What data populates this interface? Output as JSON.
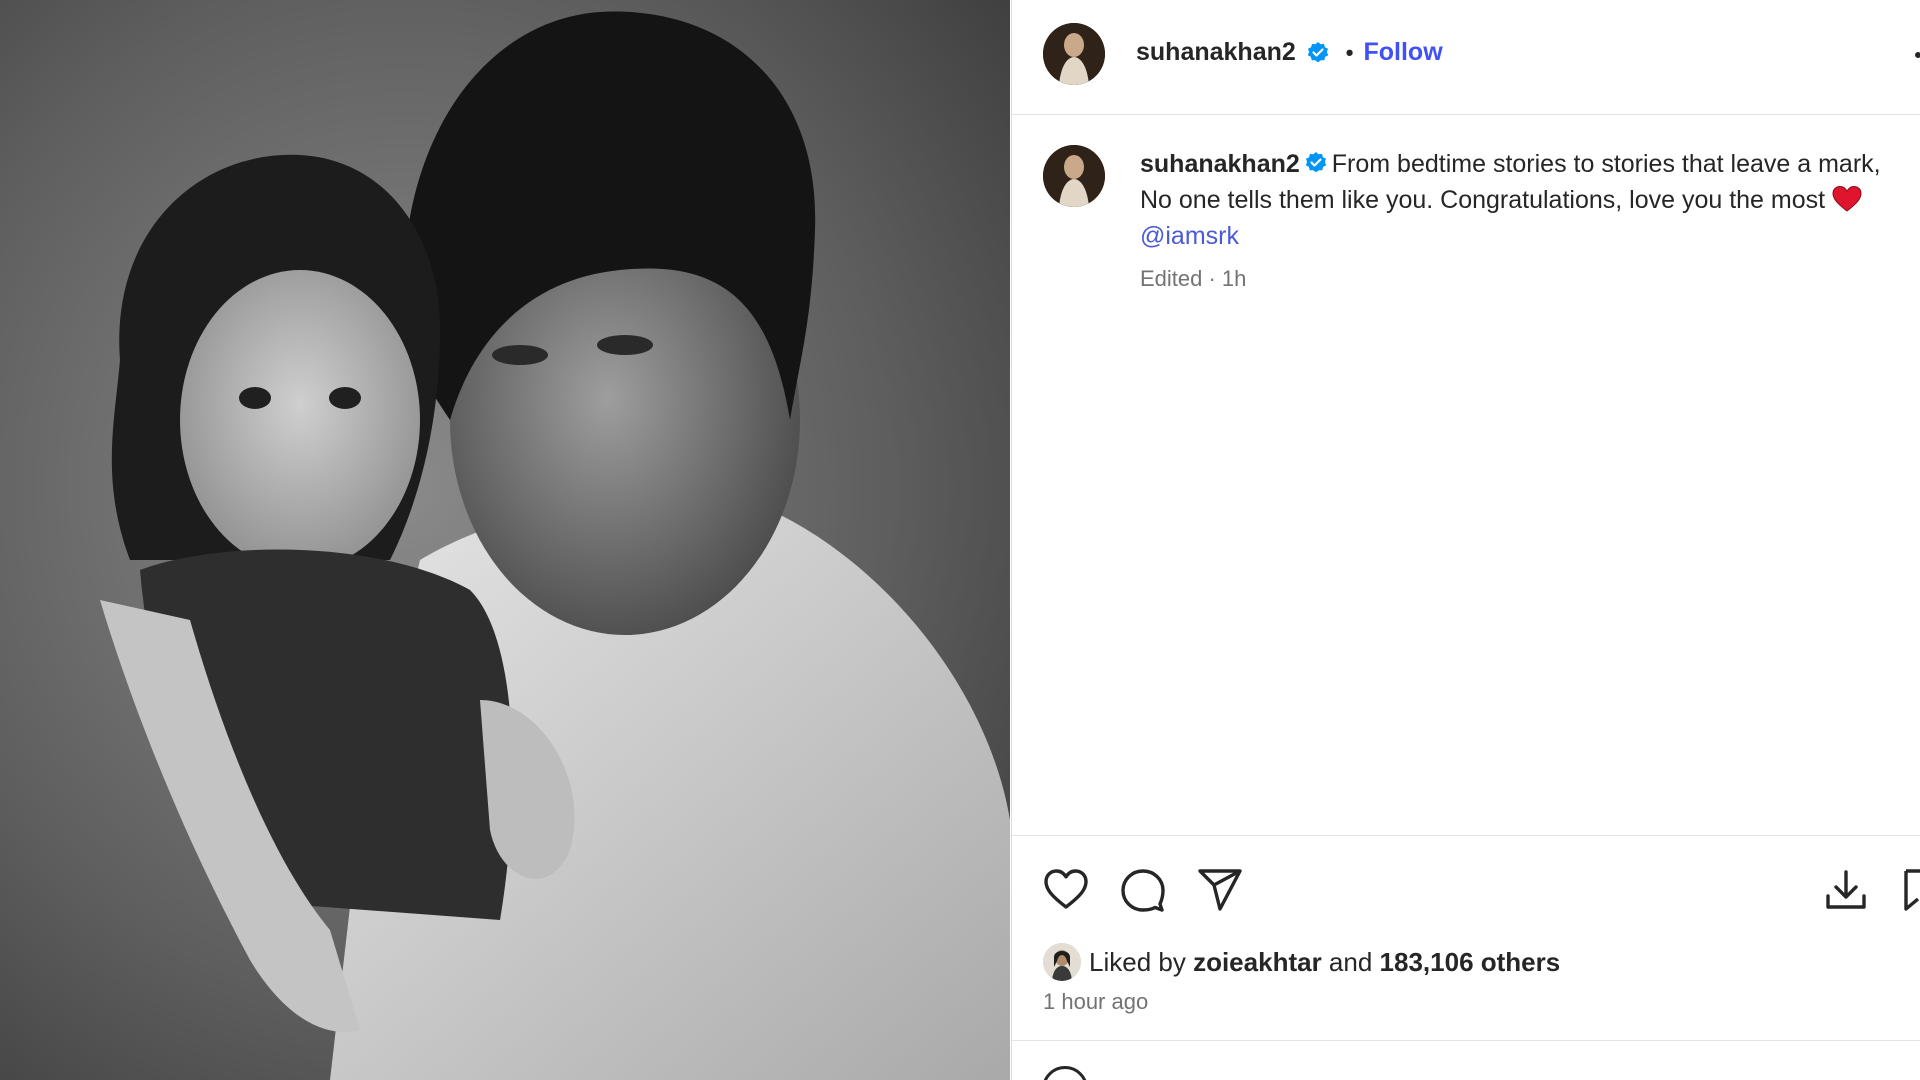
{
  "post": {
    "username": "suhanakhan2",
    "separator": "•",
    "follow_label": "Follow",
    "caption_text": "From bedtime stories to stories that leave a mark, No one tells them like you. Congratulations, love you the most",
    "caption_emoji": "heart-emoji",
    "mention": "@iamsrk",
    "edited_meta": "Edited · 1h",
    "liked_by_prefix": "Liked by",
    "liked_by_user": "zoieakhtar",
    "liked_by_mid": "and",
    "liked_by_count": "183,106 others",
    "timestamp": "1 hour ago"
  },
  "icons": {
    "verified": "verified-badge-icon",
    "like": "heart-outline-icon",
    "comment": "comment-bubble-icon",
    "share": "paper-plane-icon",
    "download": "download-icon",
    "save": "bookmark-icon",
    "more": "more-dots-icon"
  },
  "colors": {
    "follow": "#4150f7",
    "mention": "#4a5bd4",
    "verified": "#0095f6",
    "muted_text": "#737373",
    "heart_emoji": "#e0152d"
  }
}
